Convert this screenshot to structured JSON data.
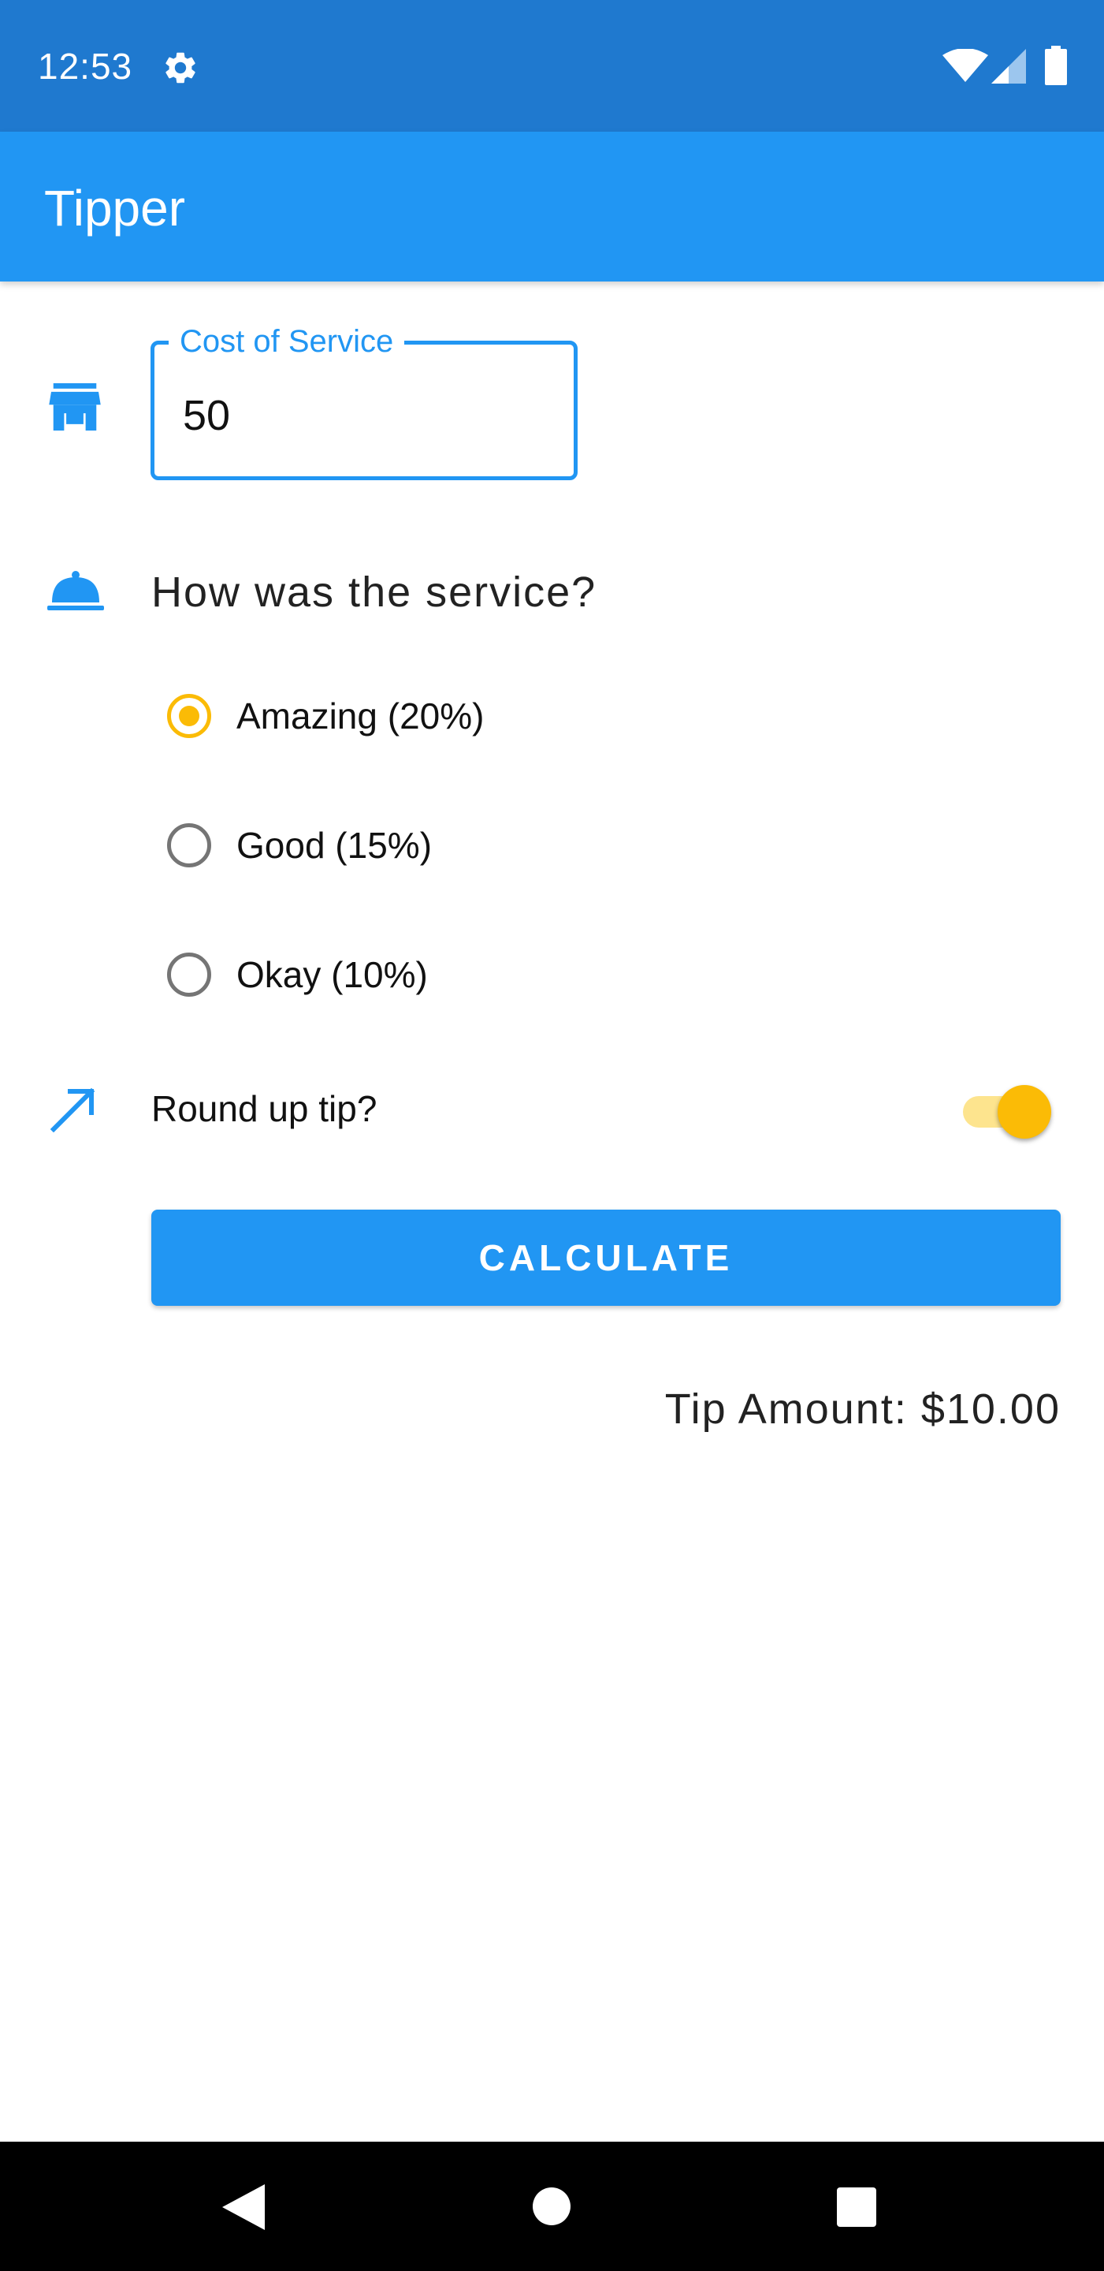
{
  "status_bar": {
    "time": "12:53",
    "icons": [
      "gear-icon",
      "wifi-icon",
      "cell-signal-icon",
      "battery-icon"
    ]
  },
  "app_bar": {
    "title": "Tipper"
  },
  "cost_field": {
    "icon": "store-icon",
    "label": "Cost of Service",
    "value": "50"
  },
  "service": {
    "icon": "bell-icon",
    "question": "How was the service?",
    "options": [
      {
        "label": "Amazing (20%)",
        "selected": true
      },
      {
        "label": "Good (15%)",
        "selected": false
      },
      {
        "label": "Okay (10%)",
        "selected": false
      }
    ]
  },
  "round_up": {
    "icon": "trending-up-arrow-icon",
    "label": "Round up tip?",
    "enabled": true
  },
  "calculate_button": {
    "label": "CALCULATE"
  },
  "result": {
    "tip_amount": "Tip Amount: $10.00"
  },
  "nav_bar": {
    "icons": [
      "back-icon",
      "home-icon",
      "recents-icon"
    ]
  },
  "colors": {
    "status_bar": "#1f79cf",
    "primary": "#2196f3",
    "accent": "#fbbb06",
    "switch_track": "#fde48e",
    "radio_unchecked": "#757575",
    "text": "#222222"
  }
}
